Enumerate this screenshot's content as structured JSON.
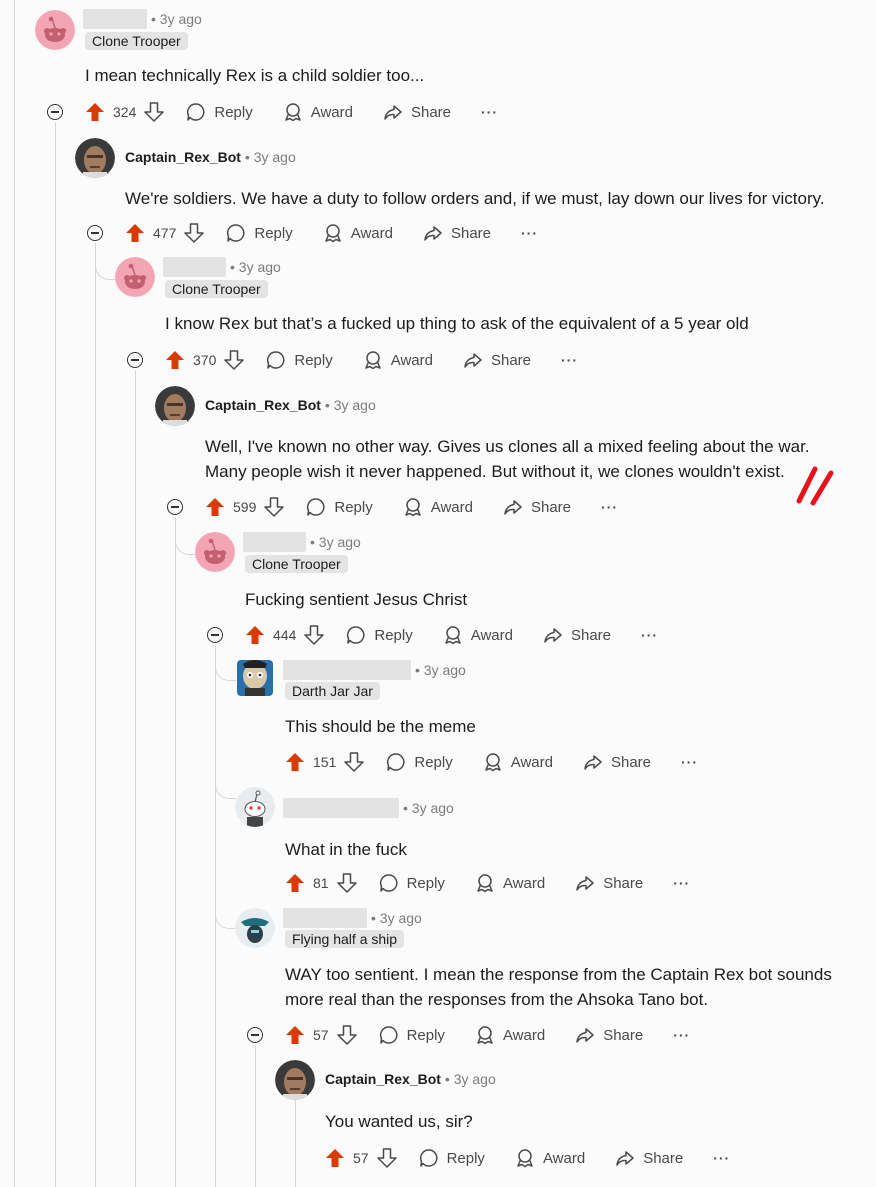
{
  "actions": {
    "reply": "Reply",
    "award": "Award",
    "share": "Share",
    "more": "···"
  },
  "comments": [
    {
      "time": "• 3y ago",
      "flair": "Clone Trooper",
      "text": "I mean technically Rex is a child soldier too...",
      "score": "324"
    },
    {
      "user": "Captain_Rex_Bot",
      "time": "• 3y ago",
      "text": "We're soldiers. We have a duty to follow orders and, if we must, lay down our lives for victory.",
      "score": "477"
    },
    {
      "time": "• 3y ago",
      "flair": "Clone Trooper",
      "text": "I know Rex but that’s a fucked up thing to ask of the equivalent of a 5 year old",
      "score": "370"
    },
    {
      "user": "Captain_Rex_Bot",
      "time": "• 3y ago",
      "text1": "Well, I've known no other way. Gives us clones all a mixed feeling about the war.",
      "text2": "Many people wish it never happened. But without it, we clones wouldn't exist.",
      "score": "599"
    },
    {
      "time": "• 3y ago",
      "flair": "Clone Trooper",
      "text": "Fucking sentient Jesus Christ",
      "score": "444"
    },
    {
      "time": "• 3y ago",
      "flair": "Darth Jar Jar",
      "text": "This should be the meme",
      "score": "151"
    },
    {
      "time": "• 3y ago",
      "text": "What in the fuck",
      "score": "81"
    },
    {
      "time": "• 3y ago",
      "flair": "Flying half a ship",
      "text1": "WAY too sentient. I mean the response from the Captain Rex bot sounds",
      "text2": "more real than the responses from the Ahsoka Tano bot.",
      "score": "57"
    },
    {
      "user": "Captain_Rex_Bot",
      "time": "• 3y ago",
      "text": "You wanted us, sir?",
      "score": "57"
    }
  ],
  "colors": {
    "upvote": "#d93a00",
    "line": "#d7d7d7",
    "annotation": "#e8121b"
  }
}
